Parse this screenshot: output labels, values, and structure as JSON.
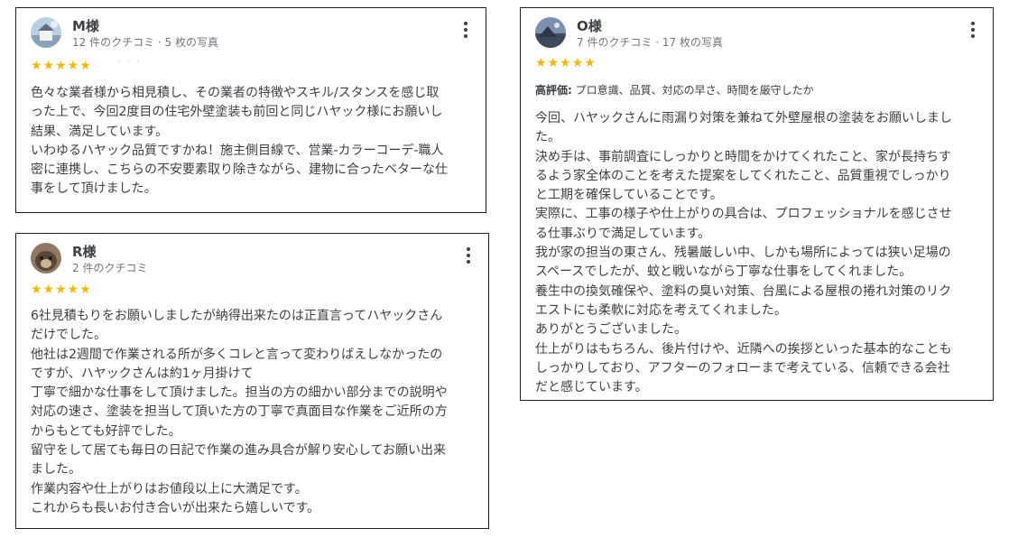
{
  "reviews": [
    {
      "name": "M様",
      "meta": "12 件のクチコミ · 5 枚の写真",
      "stars": "★★★★★",
      "highlights_label": "",
      "highlights": "",
      "lines": [
        "色々な業者様から相見積し、その業者の特徴やスキル/スタンスを感じ取",
        "った上で、今回2度目の住宅外壁塗装も前回と同じハヤック様にお願いし",
        "結果、満足しています。",
        "いわゆるハヤック品質ですかね！施主側目線で、営業-カラーコーデ-職人",
        "密に連携し、こちらの不安要素取り除きながら、建物に合ったベターな仕",
        "事をして頂けました。"
      ]
    },
    {
      "name": "R様",
      "meta": "2 件のクチコミ",
      "stars": "★★★★★",
      "lines": [
        "6社見積もりをお願いしましたが納得出来たのは正直言ってハヤックさん",
        "だけでした。",
        "他社は2週間で作業される所が多くコレと言って変わりばえしなかったの",
        "ですが、ハヤックさんは約1ヶ月掛けて",
        "丁寧で細かな仕事をして頂けました。担当の方の細かい部分までの説明や",
        "対応の速さ、塗装を担当して頂いた方の丁寧で真面目な作業をご近所の方",
        "からもとても好評でした。",
        "留守をして居ても毎日の日記で作業の進み具合が解り安心してお願い出来",
        "ました。",
        "作業内容や仕上がりはお値段以上に大満足です。",
        "これからも長いお付き合いが出来たら嬉しいです。"
      ]
    },
    {
      "name": "O様",
      "meta": "7 件のクチコミ · 17 枚の写真",
      "stars": "★★★★★",
      "highlights_label": "高評価:",
      "highlights": " プロ意識、品質、対応の早さ、時間を厳守したか",
      "lines": [
        "今回、ハヤックさんに雨漏り対策を兼ねて外壁屋根の塗装をお願いしまし",
        "た。",
        "決め手は、事前調査にしっかりと時間をかけてくれたこと、家が長持ちす",
        "るよう家全体のことを考えた提案をしてくれたこと、品質重視でしっかり",
        "と工期を確保していることです。",
        "実際に、工事の様子や仕上がりの具合は、プロフェッショナルを感じさせ",
        "る仕事ぶりで満足しています。",
        "我が家の担当の東さん、残暑厳しい中、しかも場所によっては狭い足場の",
        "スペースでしたが、蚊と戦いながら丁寧な仕事をしてくれました。",
        "養生中の換気確保や、塗料の臭い対策、台風による屋根の捲れ対策のリク",
        "エストにも柔軟に対応を考えてくれました。",
        "ありがとうございました。",
        "仕上がりはもちろん、後片付けや、近隣への挨拶といった基本的なことも",
        "しっかりしており、アフターのフォローまで考えている、信頼できる会社",
        "だと感じています。"
      ]
    }
  ],
  "colors": {
    "star": "#f5b800",
    "text": "#3c4043",
    "meta": "#70757a",
    "border": "#1f1f1f"
  },
  "icons": {
    "more": "more-vert-icon",
    "rating": "star-icon"
  }
}
